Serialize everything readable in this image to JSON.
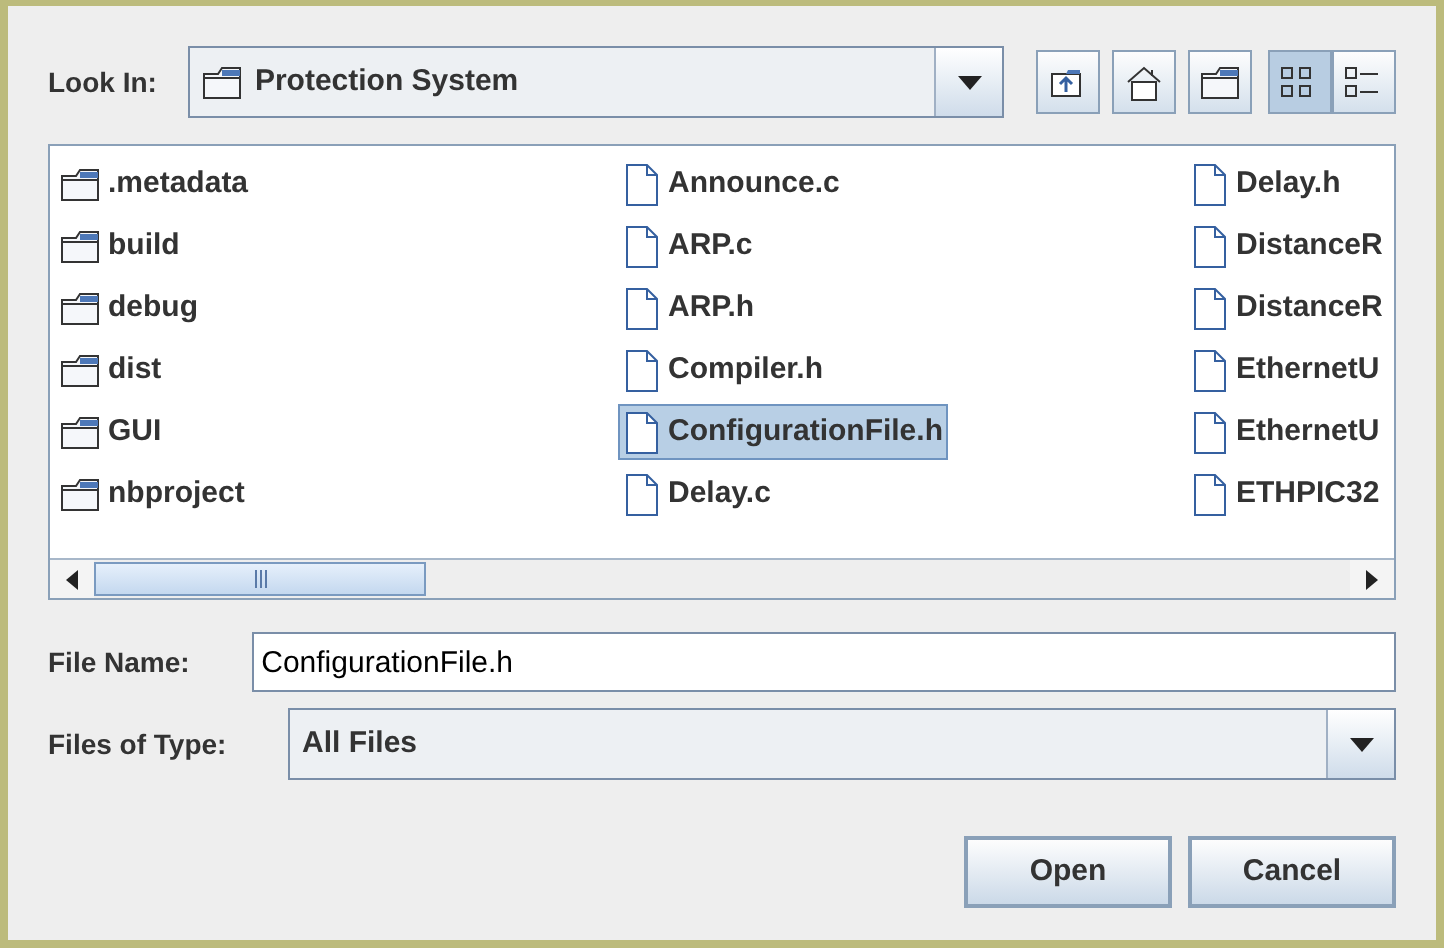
{
  "look_in": {
    "label": "Look In:",
    "value": "Protection System"
  },
  "toolbar": [
    {
      "kind": "up",
      "selected": false
    },
    {
      "kind": "home",
      "selected": false
    },
    {
      "kind": "new-folder",
      "selected": false
    },
    {
      "kind": "list",
      "selected": true
    },
    {
      "kind": "details",
      "selected": false
    }
  ],
  "files": [
    {
      "name": ".metadata",
      "kind": "folder",
      "selected": false
    },
    {
      "name": "build",
      "kind": "folder",
      "selected": false
    },
    {
      "name": "debug",
      "kind": "folder",
      "selected": false
    },
    {
      "name": "dist",
      "kind": "folder",
      "selected": false
    },
    {
      "name": "GUI",
      "kind": "folder",
      "selected": false
    },
    {
      "name": "nbproject",
      "kind": "folder",
      "selected": false
    },
    {
      "name": "Announce.c",
      "kind": "file",
      "selected": false
    },
    {
      "name": "ARP.c",
      "kind": "file",
      "selected": false
    },
    {
      "name": "ARP.h",
      "kind": "file",
      "selected": false
    },
    {
      "name": "Compiler.h",
      "kind": "file",
      "selected": false
    },
    {
      "name": "ConfigurationFile.h",
      "kind": "file",
      "selected": true
    },
    {
      "name": "Delay.c",
      "kind": "file",
      "selected": false
    },
    {
      "name": "Delay.h",
      "kind": "file",
      "selected": false
    },
    {
      "name": "DistanceR",
      "kind": "file",
      "selected": false
    },
    {
      "name": "DistanceR",
      "kind": "file",
      "selected": false
    },
    {
      "name": "EthernetU",
      "kind": "file",
      "selected": false
    },
    {
      "name": "EthernetU",
      "kind": "file",
      "selected": false
    },
    {
      "name": "ETHPIC32",
      "kind": "file",
      "selected": false
    }
  ],
  "file_name": {
    "label": "File Name:",
    "value": "ConfigurationFile.h"
  },
  "file_type": {
    "label": "Files of Type:",
    "value": "All Files"
  },
  "buttons": [
    "Open",
    "Cancel"
  ]
}
